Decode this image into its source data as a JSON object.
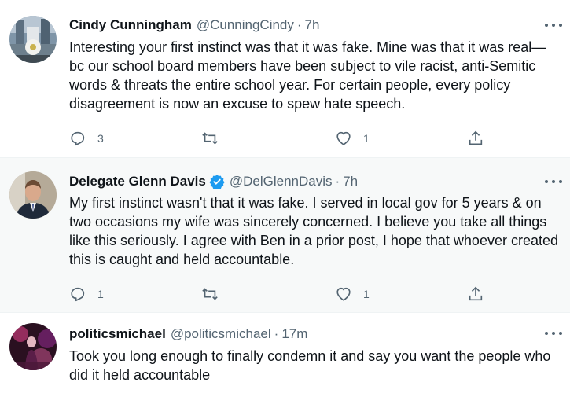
{
  "tweets": [
    {
      "name": "Cindy Cunningham",
      "handle": "@CunningCindy",
      "separator": "·",
      "time": "7h",
      "verified": false,
      "text": "Interesting your first instinct was that it was fake. Mine was that it was real—bc our school board members have been subject to vile racist, anti-Semitic words & threats the entire school year. For certain people, every policy disagreement is now an excuse to spew hate speech.",
      "reply_count": "3",
      "retweet_count": "",
      "like_count": "1"
    },
    {
      "name": "Delegate Glenn Davis",
      "handle": "@DelGlennDavis",
      "separator": "·",
      "time": "7h",
      "verified": true,
      "text": "My first instinct wasn't that it was fake. I served in local gov for 5 years & on two occasions my wife was sincerely concerned. I believe you take all things like this seriously. I agree with Ben in a prior post, I hope that whoever created this is caught and held accountable.",
      "reply_count": "1",
      "retweet_count": "",
      "like_count": "1"
    },
    {
      "name": "politicsmichael",
      "handle": "@politicsmichael",
      "separator": "·",
      "time": "17m",
      "verified": false,
      "text": "Took you long enough to finally condemn it and say you want the people who did it held accountable"
    }
  ],
  "icons": {
    "more": "more-icon",
    "reply": "reply-icon",
    "retweet": "retweet-icon",
    "like": "like-icon",
    "share": "share-icon",
    "verified": "verified-badge-icon"
  },
  "colors": {
    "text": "#0f1419",
    "secondary": "#536471",
    "verified": "#1d9bf0",
    "highlight_bg": "#f7f9f9",
    "thread_line": "#cfd9de"
  }
}
